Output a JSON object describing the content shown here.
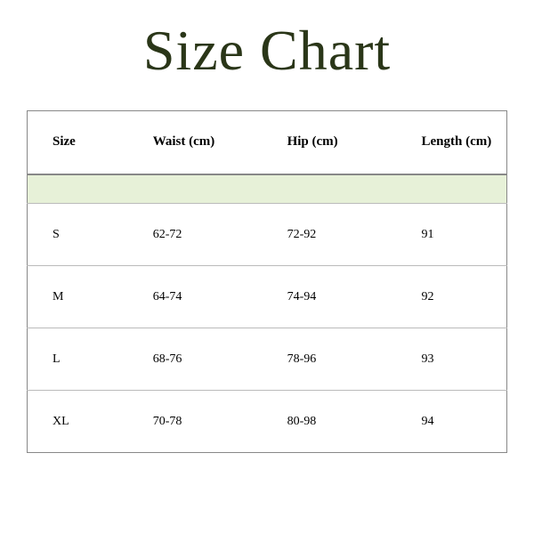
{
  "title": "Size Chart",
  "headers": {
    "size": "Size",
    "waist": "Waist (cm)",
    "hip": "Hip (cm)",
    "length": "Length (cm)"
  },
  "rows": [
    {
      "size": "S",
      "waist": "62-72",
      "hip": "72-92",
      "length": "91"
    },
    {
      "size": "M",
      "waist": "64-74",
      "hip": "74-94",
      "length": "92"
    },
    {
      "size": "L",
      "waist": "68-76",
      "hip": "78-96",
      "length": "93"
    },
    {
      "size": "XL",
      "waist": "70-78",
      "hip": "80-98",
      "length": "94"
    }
  ],
  "chart_data": {
    "type": "table",
    "title": "Size Chart",
    "columns": [
      "Size",
      "Waist (cm)",
      "Hip (cm)",
      "Length (cm)"
    ],
    "data": [
      [
        "S",
        "62-72",
        "72-92",
        91
      ],
      [
        "M",
        "64-74",
        "74-94",
        92
      ],
      [
        "L",
        "68-76",
        "78-96",
        93
      ],
      [
        "XL",
        "70-78",
        "80-98",
        94
      ]
    ]
  }
}
